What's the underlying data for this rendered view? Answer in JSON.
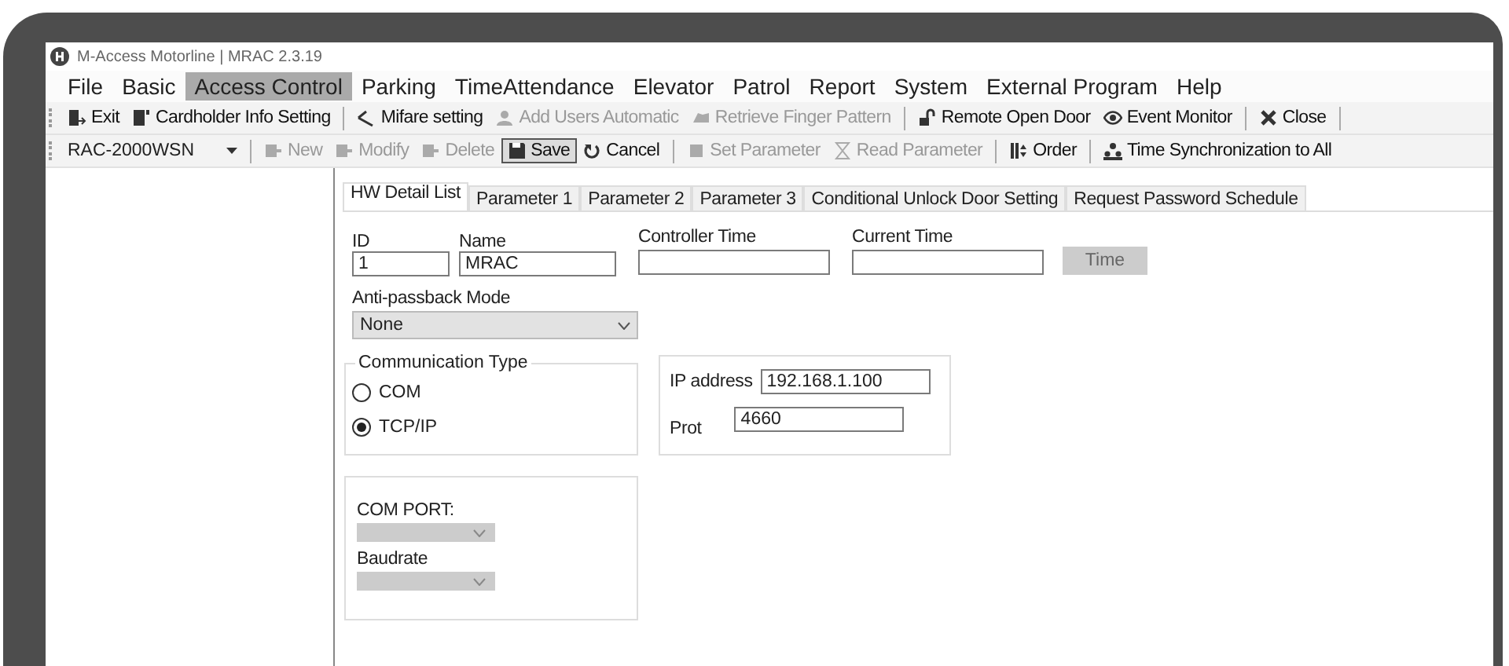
{
  "window": {
    "title": "M-Access Motorline | MRAC  2.3.19"
  },
  "menu": [
    {
      "label": "File",
      "selected": false
    },
    {
      "label": "Basic",
      "selected": false
    },
    {
      "label": "Access Control",
      "selected": true
    },
    {
      "label": "Parking",
      "selected": false
    },
    {
      "label": "TimeAttendance",
      "selected": false
    },
    {
      "label": "Elevator",
      "selected": false
    },
    {
      "label": "Patrol",
      "selected": false
    },
    {
      "label": "Report",
      "selected": false
    },
    {
      "label": "System",
      "selected": false
    },
    {
      "label": "External Program",
      "selected": false
    },
    {
      "label": "Help",
      "selected": false
    }
  ],
  "toolbar_1": [
    [
      {
        "label": "Exit",
        "disabled": false
      },
      {
        "label": "Cardholder Info Setting",
        "disabled": false
      }
    ],
    [
      {
        "label": "Mifare setting",
        "disabled": false
      },
      {
        "label": "Add Users Automatic",
        "disabled": true
      },
      {
        "label": "Retrieve Finger Pattern",
        "disabled": true
      }
    ],
    [
      {
        "label": "Remote Open Door",
        "disabled": false
      },
      {
        "label": "Event Monitor",
        "disabled": false
      }
    ],
    [
      {
        "label": "Close",
        "disabled": false
      }
    ]
  ],
  "toolbar_2": {
    "device_select": "RAC-2000WSN",
    "groups": [
      [
        {
          "label": "New",
          "disabled": true,
          "pressed": false
        },
        {
          "label": "Modify",
          "disabled": true,
          "pressed": false
        },
        {
          "label": "Delete",
          "disabled": true,
          "pressed": false
        },
        {
          "label": "Save",
          "disabled": false,
          "pressed": true
        },
        {
          "label": "Cancel",
          "disabled": false,
          "pressed": false
        }
      ],
      [
        {
          "label": "Set Parameter",
          "disabled": true,
          "pressed": false
        },
        {
          "label": "Read Parameter",
          "disabled": true,
          "pressed": false
        }
      ],
      [
        {
          "label": "Order",
          "disabled": false,
          "pressed": false
        }
      ],
      [
        {
          "label": "Time Synchronization to All",
          "disabled": false,
          "pressed": false
        }
      ]
    ]
  },
  "tabs": [
    {
      "label": "HW Detail List",
      "selected": true
    },
    {
      "label": "Parameter 1",
      "selected": false
    },
    {
      "label": "Parameter 2",
      "selected": false
    },
    {
      "label": "Parameter 3",
      "selected": false
    },
    {
      "label": "Conditional Unlock Door Setting",
      "selected": false
    },
    {
      "label": "Request Password Schedule",
      "selected": false
    }
  ],
  "form": {
    "id": {
      "label": "ID",
      "value": "1"
    },
    "name": {
      "label": "Name",
      "value": "MRAC"
    },
    "controller_time": {
      "label": "Controller Time"
    },
    "current_time": {
      "label": "Current Time"
    },
    "time_button": {
      "label": "Time",
      "disabled": true
    },
    "anti_passback": {
      "label": "Anti-passback Mode",
      "value": "None"
    },
    "communication_type": {
      "title": "Communication Type",
      "options": [
        {
          "label": "COM",
          "selected": false
        },
        {
          "label": "TCP/IP",
          "selected": true
        }
      ]
    },
    "ip_address": {
      "label": "IP address",
      "value": "192.168.1.100"
    },
    "port": {
      "label": "Prot",
      "value": "4660"
    },
    "com_port": {
      "label": "COM PORT:",
      "disabled": true
    },
    "baudrate": {
      "label": "Baudrate",
      "disabled": true
    }
  }
}
